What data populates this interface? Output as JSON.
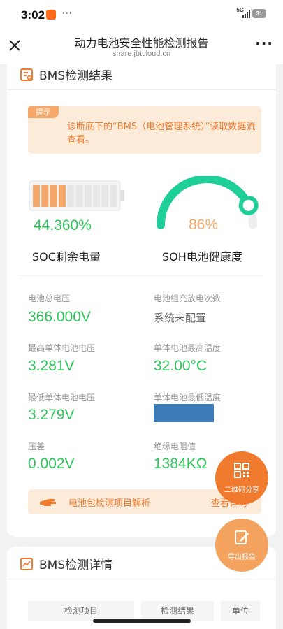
{
  "status_bar": {
    "time": "3:02",
    "network": "5G",
    "battery": "31"
  },
  "nav": {
    "title": "动力电池安全性能检测报告",
    "subtitle": "share.jbtcloud.cn"
  },
  "bms_result": {
    "title": "BMS检测结果",
    "tip": {
      "badge": "提示",
      "text": "诊断底下的“BMS（电池管理系统）”读取数据流查看。"
    },
    "soc": {
      "value": "44.360%",
      "label": "SOC剩余电量",
      "level": 0.44
    },
    "soh": {
      "value": "86%",
      "label": "SOH电池健康度",
      "level": 0.86
    },
    "metrics": [
      {
        "label": "电池总电压",
        "value": "366.000V"
      },
      {
        "label": "电池组充放电次数",
        "value": "系统未配置"
      },
      {
        "label": "最高单体电池电压",
        "value": "3.281V"
      },
      {
        "label": "单体电池最高温度",
        "value": "32.00°C"
      },
      {
        "label": "最低单体电池电压",
        "value": "3.279V"
      },
      {
        "label": "单体电池最低温度",
        "value": ""
      },
      {
        "label": "压差",
        "value": "0.002V"
      },
      {
        "label": "绝缘电阻值",
        "value": "1384KΩ"
      }
    ],
    "parse_bar": {
      "text": "电池包检测项目解析",
      "link": "查看详情"
    }
  },
  "fab": {
    "share": "二维码分享",
    "export": "导出报告"
  },
  "bms_detail": {
    "title": "BMS检测详情",
    "columns": [
      "检测项目",
      "检测结果",
      "单位"
    ]
  },
  "colors": {
    "accent": "#f07b2e",
    "green": "#2fc45a",
    "teal": "#1fcf9a"
  }
}
